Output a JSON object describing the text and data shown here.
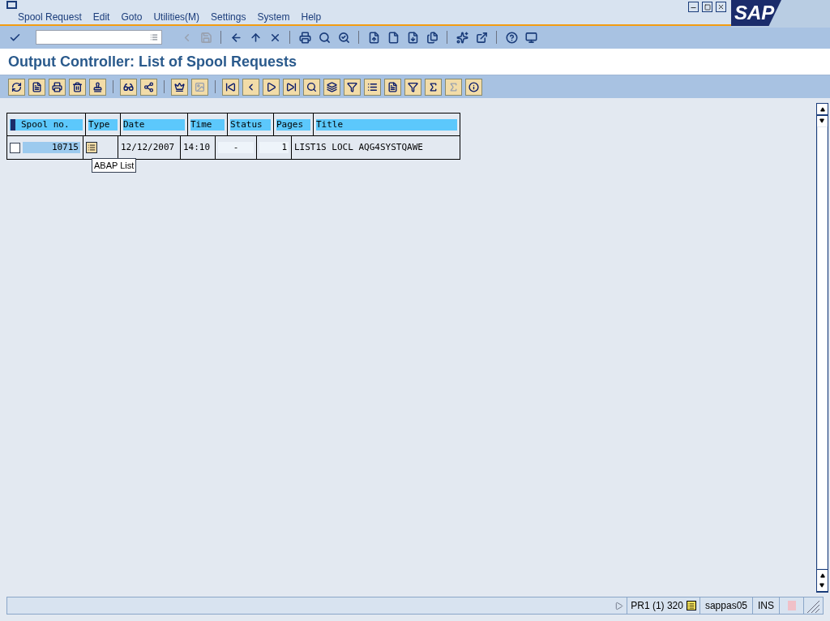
{
  "menu": [
    {
      "label": "Spool Request"
    },
    {
      "label": "Edit"
    },
    {
      "label": "Goto"
    },
    {
      "label": "Utilities(M)"
    },
    {
      "label": "Settings"
    },
    {
      "label": "System"
    },
    {
      "label": "Help"
    }
  ],
  "logo": "SAP",
  "title": "Output Controller: List of Spool Requests",
  "table": {
    "columns": [
      "Spool no.",
      "Type",
      "Date",
      "Time",
      "Status",
      "Pages",
      "Title"
    ],
    "rows": [
      {
        "checked": false,
        "spool_no": "10715",
        "date": "12/12/2007",
        "time": "14:10",
        "status": "-",
        "pages": "1",
        "title": "LIST1S LOCL AQG4SYSTQAWE"
      }
    ]
  },
  "tooltip": "ABAP List",
  "status_bar": {
    "system": "PR1 (1) 320",
    "server": "sappas05",
    "mode": "INS"
  }
}
